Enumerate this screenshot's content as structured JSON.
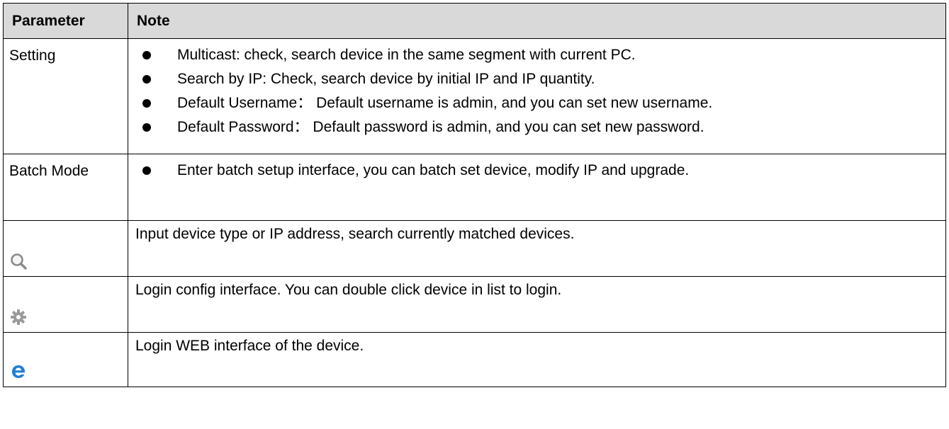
{
  "table": {
    "headers": {
      "parameter": "Parameter",
      "note": "Note"
    },
    "rows": {
      "setting": {
        "parameter": "Setting",
        "bullets": [
          "Multicast: check, search device in the same segment with current PC.",
          "Search by IP: Check, search device by initial IP and IP quantity.",
          "Default Username： Default username is admin, and you can set new username.",
          "Default Password： Default password is admin, and you can set new password."
        ]
      },
      "batch_mode": {
        "parameter": "Batch Mode",
        "bullets": [
          "Enter batch setup interface, you can batch set device, modify IP and upgrade."
        ]
      },
      "search": {
        "icon": "search-icon",
        "note": "Input device type or IP address, search currently matched devices."
      },
      "config": {
        "icon": "gear-icon",
        "note": "Login config interface. You can double click device in list to login."
      },
      "web": {
        "icon": "ie-browser-icon",
        "note": "Login WEB interface of the device."
      }
    }
  },
  "colors": {
    "header_background": "#d9d9d9",
    "border": "#000000",
    "icon_gray": "#8a8a8a",
    "ie_blue": "#1e7fd6"
  }
}
